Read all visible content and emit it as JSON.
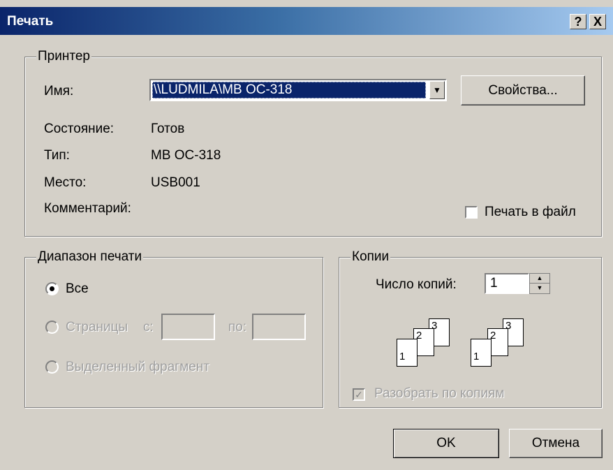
{
  "window": {
    "title": "Печать",
    "help_glyph": "?",
    "close_glyph": "X"
  },
  "printer": {
    "group_label": "Принтер",
    "name_label": "Имя:",
    "name_value": "\\\\LUDMILA\\MB OC-318",
    "properties_button": "Свойства...",
    "status_label": "Состояние:",
    "status_value": "Готов",
    "type_label": "Тип:",
    "type_value": "MB OC-318",
    "location_label": "Место:",
    "location_value": "USB001",
    "comment_label": "Комментарий:",
    "print_to_file_label": "Печать в файл",
    "print_to_file_checked": false
  },
  "range": {
    "group_label": "Диапазон печати",
    "all_label": "Все",
    "pages_label": "Страницы",
    "from_label": "с:",
    "to_label": "по:",
    "selection_label": "Выделенный фрагмент",
    "selected": "all"
  },
  "copies": {
    "group_label": "Копии",
    "count_label": "Число копий:",
    "count_value": "1",
    "collate_label": "Разобрать по копиям",
    "collate_checked": true,
    "collate_icon": {
      "set1": [
        "1",
        "2",
        "3"
      ],
      "set2": [
        "1",
        "2",
        "3"
      ]
    }
  },
  "buttons": {
    "ok": "OK",
    "cancel": "Отмена"
  }
}
